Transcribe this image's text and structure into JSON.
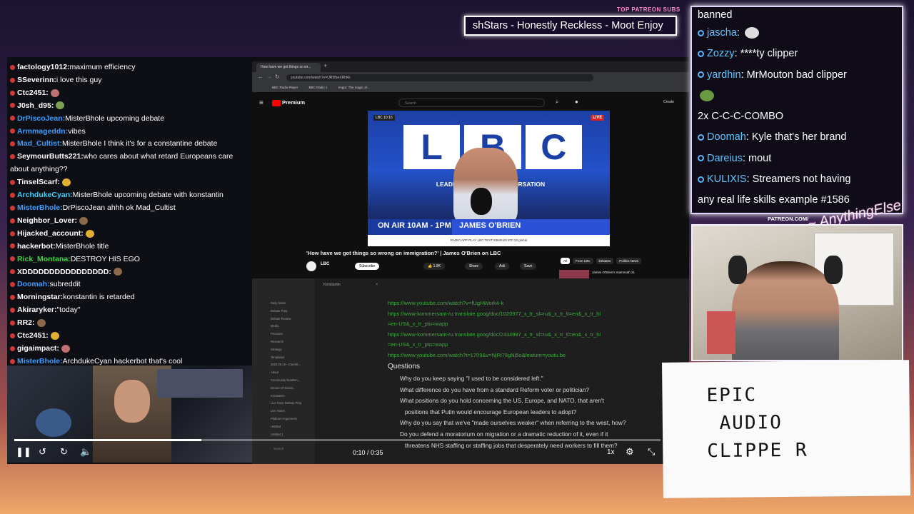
{
  "now_playing": {
    "label": "TOP PATREON SUBS",
    "song": "shStars - Honestly Reckless - Moot Enjoy"
  },
  "chat_left": [
    {
      "user": "factology1012",
      "msg": "maximum efficiency",
      "color": "#ffffff"
    },
    {
      "user": "SSeverinn",
      "msg": "i love this guy",
      "color": "#ffffff"
    },
    {
      "user": "Ctc2451",
      "msg": "",
      "color": "#ffffff"
    },
    {
      "user": "J0sh_d95",
      "msg": "",
      "color": "#ffffff"
    },
    {
      "user": "DrPiscoJean",
      "msg": "MisterBhole upcoming debate",
      "color": "#3a9dff"
    },
    {
      "user": "Armmageddn",
      "msg": "vibes",
      "color": "#3a9dff"
    },
    {
      "user": "Mad_Cultist",
      "msg": "MisterBhole I think it's for a constantine debate",
      "color": "#3a9dff"
    },
    {
      "user": "SeymourButts221",
      "msg": "who cares about what retard Europeans care",
      "color": "#ffffff"
    },
    {
      "user": "",
      "msg": "about anything??",
      "color": "#ffffff"
    },
    {
      "user": "TinselScarf",
      "msg": "",
      "color": "#ffffff"
    },
    {
      "user": "ArchdukeCyan",
      "msg": "MisterBhole upcoming debate with konstantin",
      "color": "#3ad0ff"
    },
    {
      "user": "MisterBhole",
      "msg": "DrPiscoJean ahhh ok Mad_Cultist",
      "color": "#3a9dff"
    },
    {
      "user": "Neighbor_Lover",
      "msg": "",
      "color": "#ffffff"
    },
    {
      "user": "Hijacked_account",
      "msg": "",
      "color": "#ffffff"
    },
    {
      "user": "hackerbot",
      "msg": "MisterBhole title",
      "color": "#ffffff"
    },
    {
      "user": "Rick_Montana",
      "msg": "DESTROY HIS EGO",
      "color": "#38d838"
    },
    {
      "user": "XDDDDDDDDDDDDDDDD",
      "msg": "",
      "color": "#ffffff"
    },
    {
      "user": "Doomah",
      "msg": "subreddit",
      "color": "#3a9dff"
    },
    {
      "user": "Morningstar",
      "msg": "konstantin is retarded",
      "color": "#ffffff"
    },
    {
      "user": "Akiraryker",
      "msg": "\"today\"",
      "color": "#ffffff"
    },
    {
      "user": "RR2",
      "msg": "",
      "color": "#ffffff"
    },
    {
      "user": "Ctc2451",
      "msg": "",
      "color": "#ffffff"
    },
    {
      "user": "gigaimpact",
      "msg": "",
      "color": "#ffffff"
    },
    {
      "user": "MisterBhole",
      "msg": "ArchdukeCyan hackerbot that's cool",
      "color": "#3a9dff"
    }
  ],
  "chat_right": [
    {
      "user": "",
      "msg": "banned"
    },
    {
      "user": "jascha",
      "msg": ""
    },
    {
      "user": "Zozzy",
      "msg": "****ty clipper"
    },
    {
      "user": "yardhin",
      "msg": "MrMouton bad clipper"
    },
    {
      "user": "",
      "msg": ""
    },
    {
      "user": "",
      "msg": "2x C-C-C-COMBO"
    },
    {
      "user": "Doomah",
      "msg": "Kyle that's her brand"
    },
    {
      "user": "Dareius",
      "msg": "mout"
    },
    {
      "user": "KULIXIS",
      "msg": "Streamers not having"
    },
    {
      "user": "",
      "msg": "any real life skills example #1586"
    }
  ],
  "patreon": "PATREON.COM/",
  "browser": {
    "tab_title": "How have we got things so wr...",
    "url": "youtube.com/watch?v=UR5fbeXRhKk",
    "bookmarks": [
      "BBC Radio Player",
      "BBC Radio 1",
      "Imgur: The magic of..."
    ],
    "yt_logo": "Premium",
    "search_placeholder": "Search",
    "create_label": "Create",
    "video_title": "'How have we got things so wrong on immigration?' | James O'Brien on LBC",
    "channel": "LBC",
    "subscribe": "Subscribe",
    "likes": "1.9K",
    "share": "Share",
    "ask": "Ask",
    "save": "Save",
    "chips": [
      "All",
      "From LBC",
      "Debates",
      "Politics News"
    ],
    "side_video": "James O'Brien's mammoth 21"
  },
  "video": {
    "logo": "LBC",
    "live": "LIVE",
    "time": "10:15",
    "slogan": "LEADING BRITAIN'S CONVERSATION",
    "on_air": "ON AIR 10AM - 1PM",
    "host": "JAMES O'BRIEN",
    "platforms": "RADIO  APP  PLAY LBC  TEXT 83845 80 870 33  global"
  },
  "doc": {
    "tab": "Konstantin",
    "folders": [
      "Daily News",
      "Debate Prep",
      "Debate Review",
      "Media",
      "Personal",
      "Research",
      "Strategy",
      "Templates",
      "2025.08.19 - Checkli...",
      "About",
      "Community Relation...",
      "Dream Of Social...",
      "Konstantin",
      "Live Rose Debate Prep",
      "Live Notes",
      "Platform Arguments",
      "Untitled",
      "Untitled 1"
    ],
    "search": "Search",
    "links": [
      "https://www.youtube.com/watch?v=fUgHWork4-k",
      "https://www-kommersant-ru.translate.goog/doc/1020977_x_tr_sl=ru&_x_tr_tl=en&_x_tr_hl",
      "=en-US&_x_tr_pto=wapp",
      "https://www-kommersant-ru.translate.goog/doc/2434997_x_tr_sl=ru&_x_tr_tl=en&_x_tr_hl",
      "=en-US&_x_tr_pto=wapp",
      "https://www.youtube.com/watch?t=1709&v=NjRi78gNj5o&feature=youtu.be"
    ],
    "heading": "Questions",
    "questions": [
      "Why do you keep saying \"I used to be considered left.\"",
      "What difference do you have from a standard Reform voter or politician?",
      "What positions do you hold concerning the US, Europe, and NATO, that aren't",
      "positions that Putin would encourage European leaders to adopt?",
      "Why do you say that we've \"made ourselves weaker\" when referring to the west, how?",
      "Do you defend a moratorium on migration or a dramatic reduction of it, even if it",
      "threatens NHS staffing or staffing jobs that desperately need workers to fill them?"
    ]
  },
  "player": {
    "time": "0:10 / 0:35",
    "progress": 0.29,
    "speed": "1x"
  },
  "whiteboard": "EPIC\n AUDIO\nCLIPPE R",
  "colors": {
    "accent": "#5ec6ff",
    "live": "#e31c1c",
    "lbc_blue": "#2452c9"
  }
}
